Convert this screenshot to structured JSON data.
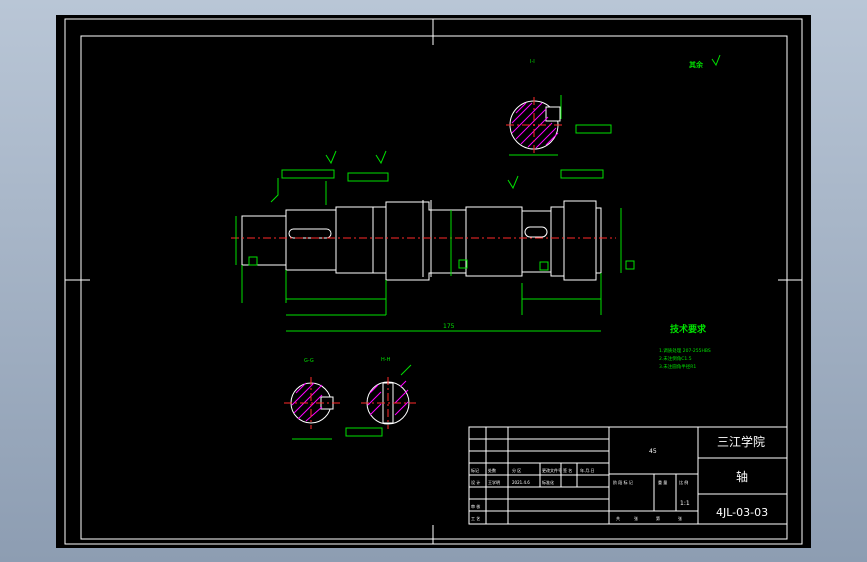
{
  "drawing": {
    "section_labels": {
      "top": "I-I",
      "left": "G-G",
      "right": "H-H"
    },
    "roughness_note": "其余",
    "tech_requirements": {
      "title": "技术要求",
      "items": [
        "1.调质处理 207-255HBS",
        "2.未注倒角C1.5",
        "3.未注圆角半径R1"
      ]
    },
    "overall_length": "175",
    "title_block": {
      "school": "三江学院",
      "part_name": "轴",
      "drawing_number": "4JL-03-03",
      "material": "45",
      "scale": "1:1",
      "row_labels": [
        "标记",
        "处数",
        "分 区",
        "更改文件号",
        "签 名",
        "年.月.日"
      ],
      "row2_labels": [
        "设 计",
        "王学明",
        "2021.4.6",
        "标准化"
      ],
      "row3_labels": [
        "审 核"
      ],
      "row4_labels": [
        "工 艺"
      ],
      "stage_labels": [
        "阶 段 标 记",
        "重 量",
        "比 例"
      ],
      "sheet_labels": [
        "共",
        "张",
        "第",
        "张"
      ]
    }
  },
  "colors": {
    "background": "#000000",
    "outline": "#ffffff",
    "dimension": "#00e000",
    "centerline": "#ff2a2a",
    "hatch": "#ff00ff",
    "frame_bg": "#9fb0c4"
  }
}
